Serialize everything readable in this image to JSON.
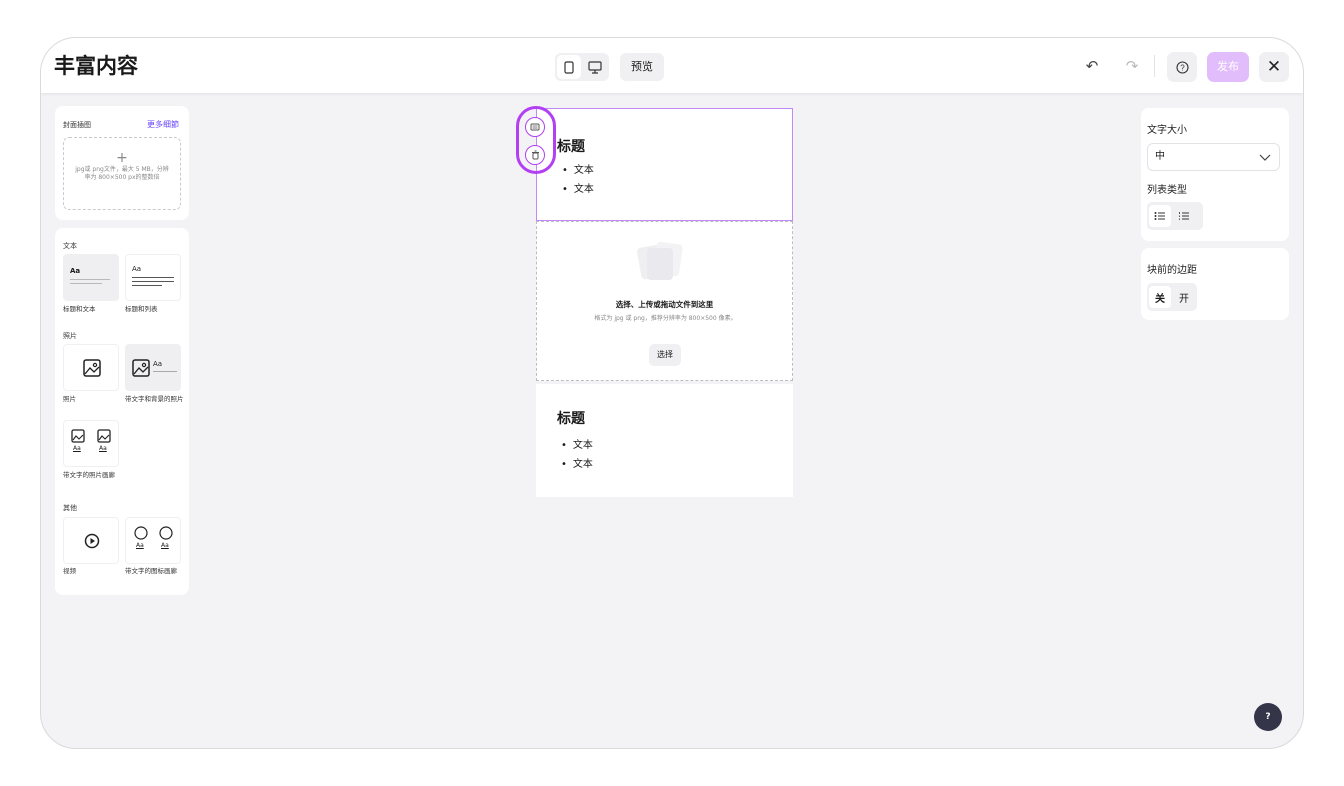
{
  "header": {
    "title": "丰富内容",
    "preview_label": "预览",
    "publish_label": "发布",
    "close_label": "✕",
    "undo_icon": "↶",
    "redo_icon": "↷"
  },
  "left_panel": {
    "cover": {
      "label": "封面插图",
      "more_link": "更多细節",
      "upload_plus": "+",
      "upload_hint": "jpg或 png文件，最大 5 MB，分辨率为 800×500 px的整数倍"
    },
    "sections": [
      {
        "title": "文本",
        "items": [
          {
            "caption": "标题和文本",
            "thumb_text": "Aa"
          },
          {
            "caption": "标题和列表",
            "thumb_text": "Aa"
          }
        ]
      },
      {
        "title": "照片",
        "items": [
          {
            "caption": "照片"
          },
          {
            "caption": "带文字和背景的照片",
            "thumb_text": "Aa"
          },
          {
            "caption": "带文字的照片画廊",
            "thumb_text": "Aa"
          }
        ]
      },
      {
        "title": "其他",
        "items": [
          {
            "caption": "视频"
          },
          {
            "caption": "带文字的图标画廊",
            "thumb_text": "Aa"
          }
        ]
      }
    ]
  },
  "canvas": {
    "block1": {
      "heading": "标题",
      "items": [
        "文本",
        "文本"
      ]
    },
    "image_block": {
      "title": "选择、上传或拖动文件到这里",
      "hint": "格式为 jpg 或 png，推荐分辨率为 800×500 像素。",
      "button": "选择"
    },
    "block2": {
      "heading": "标题",
      "items": [
        "文本",
        "文本"
      ]
    }
  },
  "right_panel": {
    "font_size_label": "文字大小",
    "font_size_value": "中",
    "list_type_label": "列表类型",
    "margin_label": "块前的边距",
    "margin_options": [
      "关",
      "开"
    ],
    "margin_selected": "关"
  },
  "help_fab": "?",
  "colors": {
    "accent": "#b23ff2",
    "publish": "#e2bdfb",
    "link": "#6b46ff",
    "canvas_bg": "#f3f3f6"
  }
}
